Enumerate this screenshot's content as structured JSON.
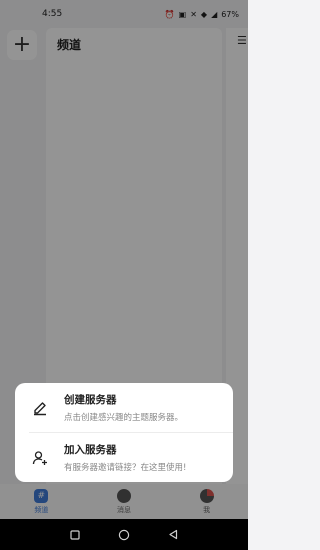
{
  "status_bar": {
    "time": "4:55",
    "battery": "67%"
  },
  "channel_panel": {
    "title": "频道"
  },
  "add_server": {
    "label": "+"
  },
  "sheet": {
    "items": [
      {
        "title": "创建服务器",
        "description": "点击创建感兴趣的主题服务器。",
        "icon": "edit-pencil-icon"
      },
      {
        "title": "加入服务器",
        "description": "有服务器邀请链接？在这里使用!",
        "icon": "add-user-icon"
      }
    ]
  },
  "tabbar": {
    "tabs": [
      {
        "label": "频道",
        "icon": "channel-icon",
        "active": true
      },
      {
        "label": "消息",
        "icon": "chat-icon",
        "active": false
      },
      {
        "label": "我",
        "icon": "profile-icon",
        "active": false
      }
    ]
  },
  "navbar": {
    "buttons": [
      "recent-apps-icon",
      "home-icon",
      "back-icon"
    ]
  },
  "colors": {
    "accent": "#3f7bd8",
    "overlay": "rgba(0,0,0,0.42)",
    "sheet_bg": "#ffffff"
  }
}
